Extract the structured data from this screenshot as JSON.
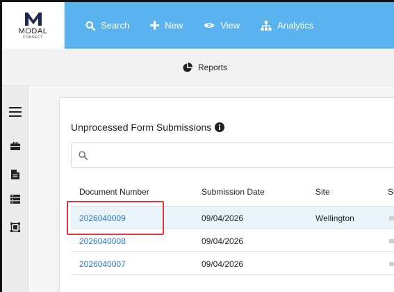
{
  "logo": {
    "name": "MODAL",
    "sub": "CONNECT"
  },
  "nav": {
    "items": [
      {
        "label": "Search",
        "icon": "search-icon"
      },
      {
        "label": "New",
        "icon": "plus-icon"
      },
      {
        "label": "View",
        "icon": "eye-icon"
      },
      {
        "label": "Analytics",
        "icon": "sitemap-icon"
      }
    ]
  },
  "subbar": {
    "reports_label": "Reports",
    "icon": "pie-chart-icon"
  },
  "sidebar": {
    "items": [
      {
        "icon": "hamburger-menu-icon"
      },
      {
        "icon": "briefcase-icon"
      },
      {
        "icon": "document-icon"
      },
      {
        "icon": "list-icon"
      },
      {
        "icon": "frame-icon"
      }
    ]
  },
  "panel": {
    "title": "Unprocessed Form Submissions",
    "info_icon": "info-icon",
    "search": {
      "value": "",
      "placeholder": ""
    }
  },
  "table": {
    "columns": [
      "Document Number",
      "Submission Date",
      "Site",
      "Su"
    ],
    "rows": [
      {
        "doc": "2026040009",
        "date": "09/04/2026",
        "site": "Wellington"
      },
      {
        "doc": "2026040008",
        "date": "09/04/2026",
        "site": ""
      },
      {
        "doc": "2026040007",
        "date": "09/04/2026",
        "site": ""
      }
    ]
  },
  "colors": {
    "nav_bg": "#5ab2ef",
    "link": "#2a73c9",
    "highlight": "#e2343d",
    "selected_row": "#eaf4fb"
  }
}
